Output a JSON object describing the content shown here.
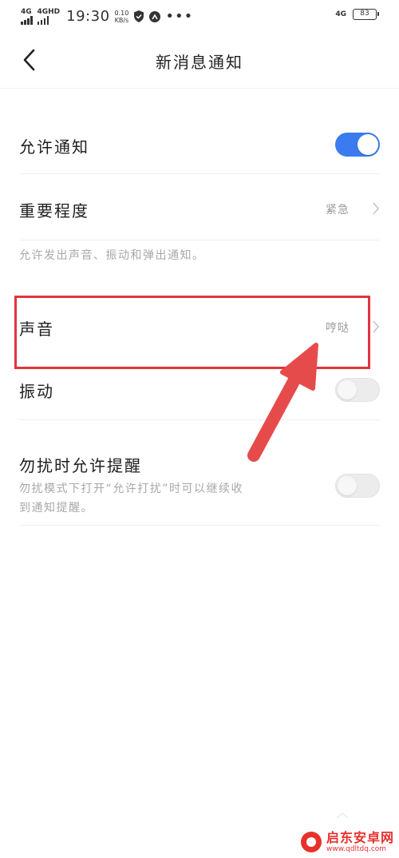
{
  "status_bar": {
    "network_1": "4G",
    "network_2": "4GHD",
    "time": "19:30",
    "speed_value": "0.10",
    "speed_unit": "KB/s",
    "more": "•••",
    "network_right": "4G",
    "battery": "83"
  },
  "header": {
    "title": "新消息通知",
    "back_icon": "chevron-left-icon"
  },
  "settings": {
    "allow_notifications": {
      "label": "允许通知",
      "toggle_on": true
    },
    "importance": {
      "label": "重要程度",
      "value": "紧急"
    },
    "hint": "允许发出声音、振动和弹出通知。",
    "sound": {
      "label": "声音",
      "value": "哼哒"
    },
    "vibration": {
      "label": "振动",
      "toggle_on": false
    },
    "dnd": {
      "label": "勿扰时允许提醒",
      "desc_line1": "勿扰模式下打开“允许打扰”时可以继续收",
      "desc_line2": "到通知提醒。",
      "toggle_on": false
    }
  },
  "annotation": {
    "highlight_color": "#e0343b",
    "arrow_color": "#e64b4b"
  },
  "watermark": {
    "name": "启东安卓网",
    "url": "www.qdltdq.com"
  },
  "colors": {
    "accent": "#3a7cf0",
    "text_primary": "#1e1e1e",
    "text_secondary": "#9a9a9a"
  }
}
